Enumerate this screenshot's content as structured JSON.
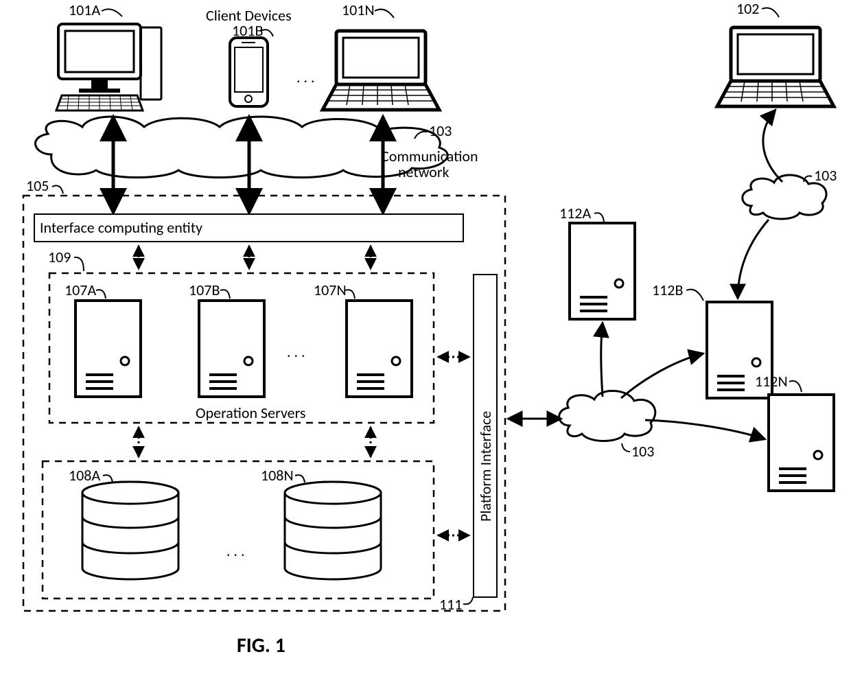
{
  "labels": {
    "clientDevices": "Client Devices",
    "commNetwork1": "Communication",
    "commNetwork2": "network",
    "interfaceEntity": "Interface computing entity",
    "operationServers": "Operation Servers",
    "platformInterface": "Platform Interface",
    "figTitle": "FIG. 1"
  },
  "refs": {
    "r101A": "101A",
    "r101B": "101B",
    "r101N": "101N",
    "r102": "102",
    "r103a": "103",
    "r103b": "103",
    "r103c": "103",
    "r105": "105",
    "r107A": "107A",
    "r107B": "107B",
    "r107N": "107N",
    "r108A": "108A",
    "r108N": "108N",
    "r109": "109",
    "r111": "111",
    "r112A": "112A",
    "r112B": "112B",
    "r112N": "112N"
  }
}
